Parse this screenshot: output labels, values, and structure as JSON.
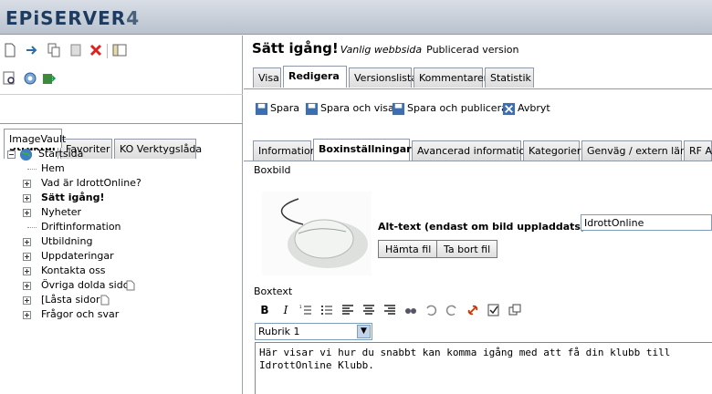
{
  "app": {
    "logo_main": "EPiSERVER",
    "logo_version": "4"
  },
  "left_toolbar": {
    "row1_icons": [
      "new-page-icon",
      "move-icon",
      "copy-icon",
      "paste-icon",
      "delete-icon",
      "preview-pane-icon"
    ],
    "row2_icons": [
      "search-icon",
      "refresh-icon",
      "export-icon"
    ]
  },
  "left_tabs": [
    "Struktur",
    "Favoriter",
    "KO Verktygslåda"
  ],
  "left_tab2": "ImageVault",
  "tree": {
    "root": "Startsida",
    "items": [
      {
        "label": "Hem",
        "expand": false,
        "bold": false
      },
      {
        "label": "Vad är IdrottOnline?",
        "expand": true,
        "bold": false
      },
      {
        "label": "Sätt igång!",
        "expand": true,
        "bold": true
      },
      {
        "label": "Nyheter",
        "expand": true,
        "bold": false
      },
      {
        "label": "Driftinformation",
        "expand": false,
        "bold": false
      },
      {
        "label": "Utbildning",
        "expand": true,
        "bold": false
      },
      {
        "label": "Uppdateringar",
        "expand": true,
        "bold": false
      },
      {
        "label": "Kontakta oss",
        "expand": true,
        "bold": false
      },
      {
        "label": "Övriga dolda sidor",
        "expand": true,
        "bold": false
      },
      {
        "label": "[Låsta sidor]",
        "expand": true,
        "bold": false
      },
      {
        "label": "Frågor och svar",
        "expand": true,
        "bold": false
      }
    ]
  },
  "page": {
    "title": "Sätt igång!",
    "subtitle": "Vanlig webbsida",
    "status": "Publicerad version"
  },
  "top_tabs": [
    "Visa",
    "Redigera",
    "Versionslista",
    "Kommentarer",
    "Statistik"
  ],
  "actions": {
    "save": "Spara",
    "save_view": "Spara och visa",
    "save_publish": "Spara och publicera",
    "cancel": "Avbryt"
  },
  "edit_tabs": [
    "Information",
    "Boxinställningar",
    "Avancerad information",
    "Kategorier",
    "Genväg / extern länk",
    "RF A"
  ],
  "form": {
    "boxbild_label": "Boxbild",
    "alt_label": "Alt-text (endast om bild uppladdats):",
    "alt_value": "IdrottOnline",
    "fetch_btn": "Hämta fil",
    "remove_btn": "Ta bort fil",
    "boxtext_label": "Boxtext",
    "format_value": "Rubrik 1",
    "content": " Här visar vi hur du snabbt kan komma igång med att få din klubb till IdrottOnline Klubb."
  },
  "colors": {
    "accent": "#1d3a5f",
    "tab_border": "#8e98a6",
    "link_red": "#cc3300"
  }
}
